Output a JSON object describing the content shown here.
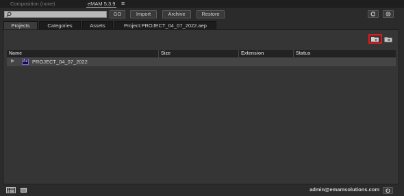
{
  "top_tabs": {
    "composition": "Composition (none)",
    "emam": "eMAM 5.3.9"
  },
  "toolbar": {
    "search_placeholder": "",
    "go_label": "GO",
    "import_label": "Import",
    "archive_label": "Archive",
    "restore_label": "Restore"
  },
  "tabs": [
    {
      "label": "Projects"
    },
    {
      "label": "Categories"
    },
    {
      "label": "Assets"
    },
    {
      "label": "Project:PROJECT_04_07_2022.aep"
    }
  ],
  "table": {
    "columns": [
      "Name",
      "Size",
      "Extension",
      "Status"
    ],
    "rows": [
      {
        "badge": "Ae",
        "name": "PROJECT_04_07_2022",
        "size": "",
        "extension": "",
        "status": ""
      }
    ]
  },
  "footer": {
    "user": "admin@emamsolutions.com"
  },
  "colors": {
    "highlight": "#e01a1a",
    "ae_badge": "#7f6bd6"
  }
}
